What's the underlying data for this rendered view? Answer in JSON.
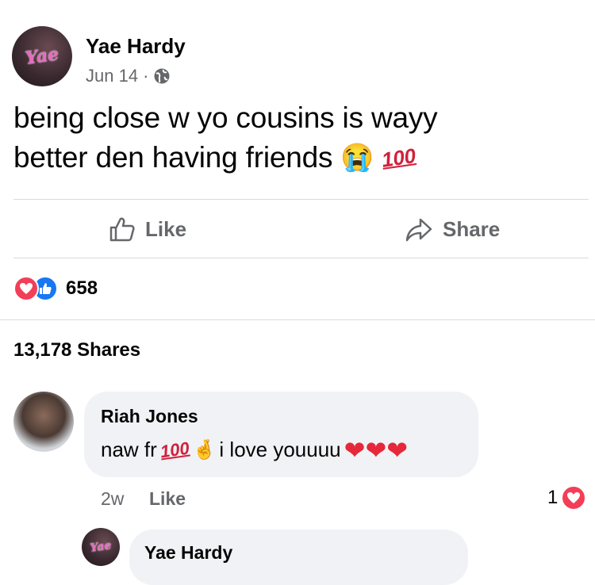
{
  "post": {
    "author": "Yae Hardy",
    "avatar_text": "Yae",
    "date": "Jun 14",
    "separator": "·",
    "audience_icon": "globe-icon",
    "text_line1": "being close w yo cousins is wayy",
    "text_line2": "better den having friends",
    "emoji_crying": "😭",
    "emoji_hundred": "100"
  },
  "actions": {
    "like_label": "Like",
    "share_label": "Share"
  },
  "reactions": {
    "count": "658",
    "types": [
      "love",
      "like"
    ]
  },
  "shares": {
    "label": "13,178 Shares"
  },
  "comments": [
    {
      "author": "Riah Jones",
      "text_before": "naw fr",
      "hundred": "100",
      "crossed_fingers": "🤞",
      "text_after": "i love youuuu",
      "hearts": "❤❤❤",
      "time": "2w",
      "like_label": "Like",
      "reaction_count": "1"
    },
    {
      "author": "Yae Hardy",
      "avatar_text": "Yae"
    }
  ],
  "colors": {
    "secondary_text": "#65676b",
    "comment_bubble": "#f0f2f5",
    "love_red": "#f33e58",
    "like_blue": "#1877f2"
  }
}
